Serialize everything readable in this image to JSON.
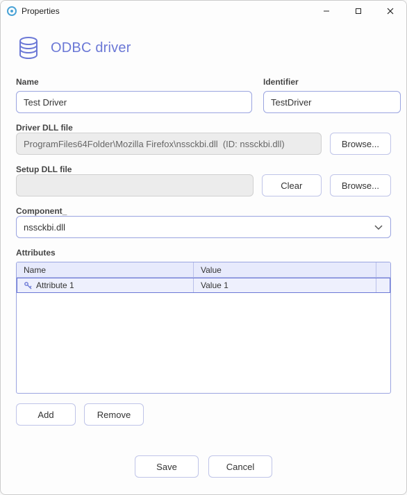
{
  "window": {
    "title": "Properties"
  },
  "header": {
    "title": "ODBC driver"
  },
  "fields": {
    "name": {
      "label": "Name",
      "value": "Test Driver"
    },
    "identifier": {
      "label": "Identifier",
      "value": "TestDriver"
    },
    "driver_dll": {
      "label": "Driver DLL file",
      "value": "ProgramFiles64Folder\\Mozilla Firefox\\nssckbi.dll  (ID: nssckbi.dll)",
      "browse": "Browse..."
    },
    "setup_dll": {
      "label": "Setup DLL file",
      "value": "",
      "clear": "Clear",
      "browse": "Browse..."
    },
    "component": {
      "label": "Component_",
      "selected": "nssckbi.dll"
    }
  },
  "attributes": {
    "label": "Attributes",
    "columns": {
      "name": "Name",
      "value": "Value"
    },
    "rows": [
      {
        "name": "Attribute 1",
        "value": "Value 1"
      }
    ],
    "add": "Add",
    "remove": "Remove"
  },
  "footer": {
    "save": "Save",
    "cancel": "Cancel"
  }
}
